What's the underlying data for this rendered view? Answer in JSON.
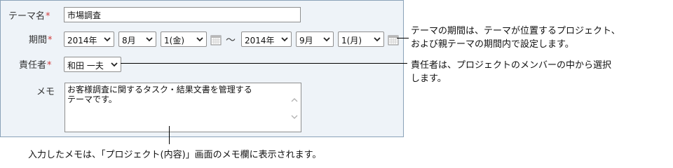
{
  "form": {
    "theme_name": {
      "label": "テーマ名",
      "required_mark": "*",
      "value": "市場調査"
    },
    "period": {
      "label": "期間",
      "required_mark": "*",
      "start": {
        "year": "2014年",
        "month": "8月",
        "day": "1(金)"
      },
      "separator": "〜",
      "end": {
        "year": "2014年",
        "month": "9月",
        "day": "1(月)"
      }
    },
    "owner": {
      "label": "責任者",
      "required_mark": "*",
      "value": "和田 一夫"
    },
    "memo": {
      "label": "メモ",
      "value_line1": "お客様調査に関するタスク・結果文書を管理する",
      "value_line2": "テーマです。"
    }
  },
  "callouts": {
    "period_line1": "テーマの期間は、テーマが位置するプロジェクト、",
    "period_line2": "および親テーマの期間内で設定します。",
    "owner_line1": "責任者は、プロジェクトのメンバーの中から選択",
    "owner_line2": "します。",
    "memo": "入力したメモは、「プロジェクト(内容)」画面のメモ欄に表示されます。"
  },
  "icons": {
    "select": "chevron-down-icon",
    "calendar": "calendar-icon",
    "scroll_up": "scroll-up-icon",
    "scroll_down": "scroll-down-icon"
  }
}
